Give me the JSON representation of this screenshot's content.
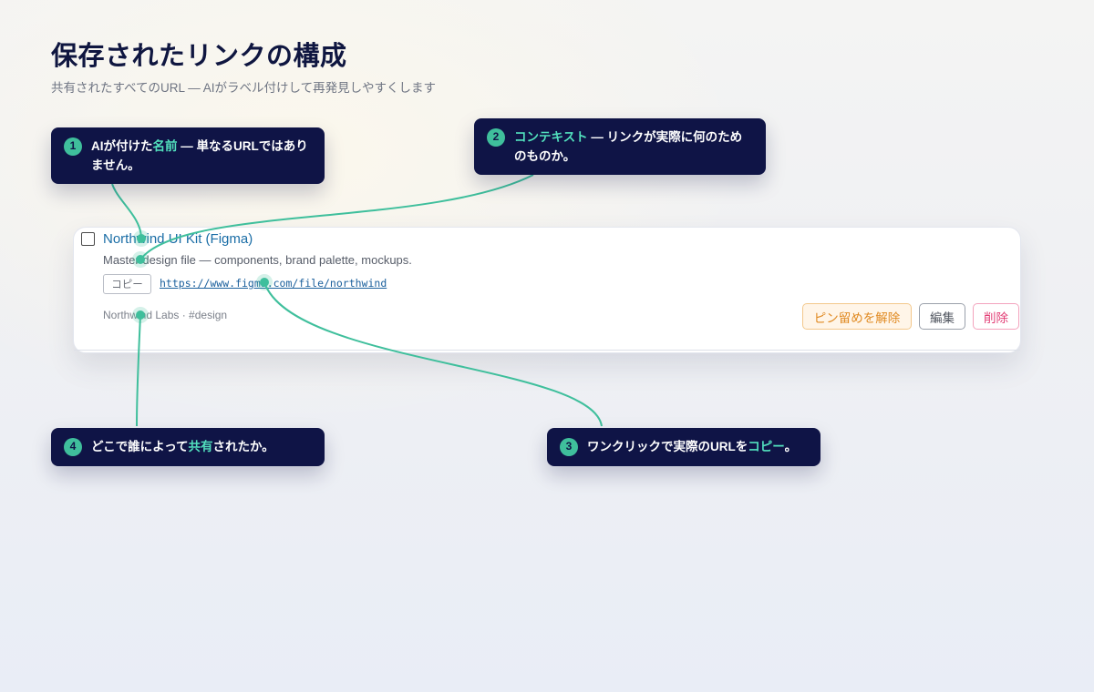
{
  "header": {
    "title": "保存されたリンクの構成",
    "subtitle": "共有されたすべてのURL — AIがラベル付けして再発見しやすくします"
  },
  "callouts": [
    {
      "number": "1",
      "before": "AIが付けた",
      "highlight": "名前",
      "after": " — 単なるURLではありません。"
    },
    {
      "number": "2",
      "before": "",
      "highlight": "コンテキスト",
      "after": " — リンクが実際に何のためのものか。"
    },
    {
      "number": "3",
      "before": "ワンクリックで実際のURLを",
      "highlight": "コピー",
      "after": "。"
    },
    {
      "number": "4",
      "before": "どこで誰によって",
      "highlight": "共有",
      "after": "されたか。"
    }
  ],
  "link_card": {
    "title": "Northwind UI Kit (Figma)",
    "description": "Master design file — components, brand palette, mockups.",
    "copy_label": "コピー",
    "url": "https://www.figma.com/file/northwind",
    "meta": "Northwind Labs · #design",
    "unpin_label": "ピン留めを解除",
    "edit_label": "編集",
    "delete_label": "削除"
  },
  "colors": {
    "callout_bg": "#0f1446",
    "accent": "#3fbf9c",
    "highlight_text": "#52e0bd",
    "link": "#1a6da6",
    "unpin": "#e08a22",
    "delete": "#e23c74"
  }
}
